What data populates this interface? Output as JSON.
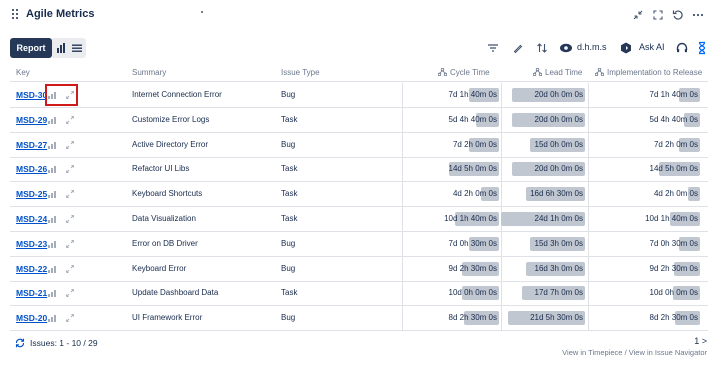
{
  "app": {
    "title": "Agile Metrics"
  },
  "toolbar": {
    "report_label": "Report",
    "time_format": "d.h.m.s",
    "ask_ai_label": "Ask AI"
  },
  "columns": {
    "key": "Key",
    "summary": "Summary",
    "issue_type": "Issue Type",
    "cycle_time": "Cycle Time",
    "lead_time": "Lead Time",
    "impl_release": "Implementation to Release"
  },
  "rows": [
    {
      "key": "MSD-30",
      "summary": "Internet Connection Error",
      "type": "Bug",
      "cycle": "7d 1h 40m 0s",
      "cycle_frac": 0.34,
      "lead": "20d 0h 0m 0s",
      "lead_frac": 0.87,
      "impl": "7d 1h 40m 0s",
      "impl_frac": 0.22
    },
    {
      "key": "MSD-29",
      "summary": "Customize Error Logs",
      "type": "Task",
      "cycle": "5d 4h 40m 0s",
      "cycle_frac": 0.26,
      "lead": "20d 0h 0m 0s",
      "lead_frac": 0.87,
      "impl": "5d 4h 40m 0s",
      "impl_frac": 0.17
    },
    {
      "key": "MSD-27",
      "summary": "Active Directory Error",
      "type": "Bug",
      "cycle": "7d 2h 0m 0s",
      "cycle_frac": 0.34,
      "lead": "15d 0h 0m 0s",
      "lead_frac": 0.65,
      "impl": "7d 2h 0m 0s",
      "impl_frac": 0.22
    },
    {
      "key": "MSD-26",
      "summary": "Refactor UI Libs",
      "type": "Task",
      "cycle": "14d 5h 0m 0s",
      "cycle_frac": 0.57,
      "lead": "20d 0h 0m 0s",
      "lead_frac": 0.87,
      "impl": "14d 5h 0m 0s",
      "impl_frac": 0.43
    },
    {
      "key": "MSD-25",
      "summary": "Keyboard Shortcuts",
      "type": "Task",
      "cycle": "4d 2h 0m 0s",
      "cycle_frac": 0.2,
      "lead": "16d 6h 30m 0s",
      "lead_frac": 0.7,
      "impl": "4d 2h 0m 0s",
      "impl_frac": 0.13
    },
    {
      "key": "MSD-24",
      "summary": "Data Visualization",
      "type": "Task",
      "cycle": "10d 1h 40m 0s",
      "cycle_frac": 0.5,
      "lead": "24d 1h 0m 0s",
      "lead_frac": 1.0,
      "impl": "10d 1h 40m 0s",
      "impl_frac": 0.31
    },
    {
      "key": "MSD-23",
      "summary": "Error on DB Driver",
      "type": "Bug",
      "cycle": "7d 0h 30m 0s",
      "cycle_frac": 0.34,
      "lead": "15d 3h 0m 0s",
      "lead_frac": 0.65,
      "impl": "7d 0h 30m 0s",
      "impl_frac": 0.22
    },
    {
      "key": "MSD-22",
      "summary": "Keyboard Error",
      "type": "Bug",
      "cycle": "9d 2h 30m 0s",
      "cycle_frac": 0.42,
      "lead": "16d 3h 0m 0s",
      "lead_frac": 0.7,
      "impl": "9d 2h 30m 0s",
      "impl_frac": 0.27
    },
    {
      "key": "MSD-21",
      "summary": "Update Dashboard Data",
      "type": "Task",
      "cycle": "10d 0h 0m 0s",
      "cycle_frac": 0.42,
      "lead": "17d 7h 0m 0s",
      "lead_frac": 0.75,
      "impl": "10d 0h 0m 0s",
      "impl_frac": 0.28
    },
    {
      "key": "MSD-20",
      "summary": "UI Framework Error",
      "type": "Bug",
      "cycle": "8d 2h 30m 0s",
      "cycle_frac": 0.4,
      "lead": "21d 5h 30m 0s",
      "lead_frac": 0.92,
      "impl": "8d 2h 30m 0s",
      "impl_frac": 0.26
    }
  ],
  "footer": {
    "issues_text": "Issues: 1 - 10 / 29",
    "pager": "1 >",
    "timepiece_link": "View in Timepiece",
    "separator": "/",
    "navigator_link": "View in Issue Navigator"
  },
  "colors": {
    "accent": "#0052cc",
    "report_bg": "#253858",
    "bar": "#c1c7d0",
    "highlight": "#d0191a"
  }
}
